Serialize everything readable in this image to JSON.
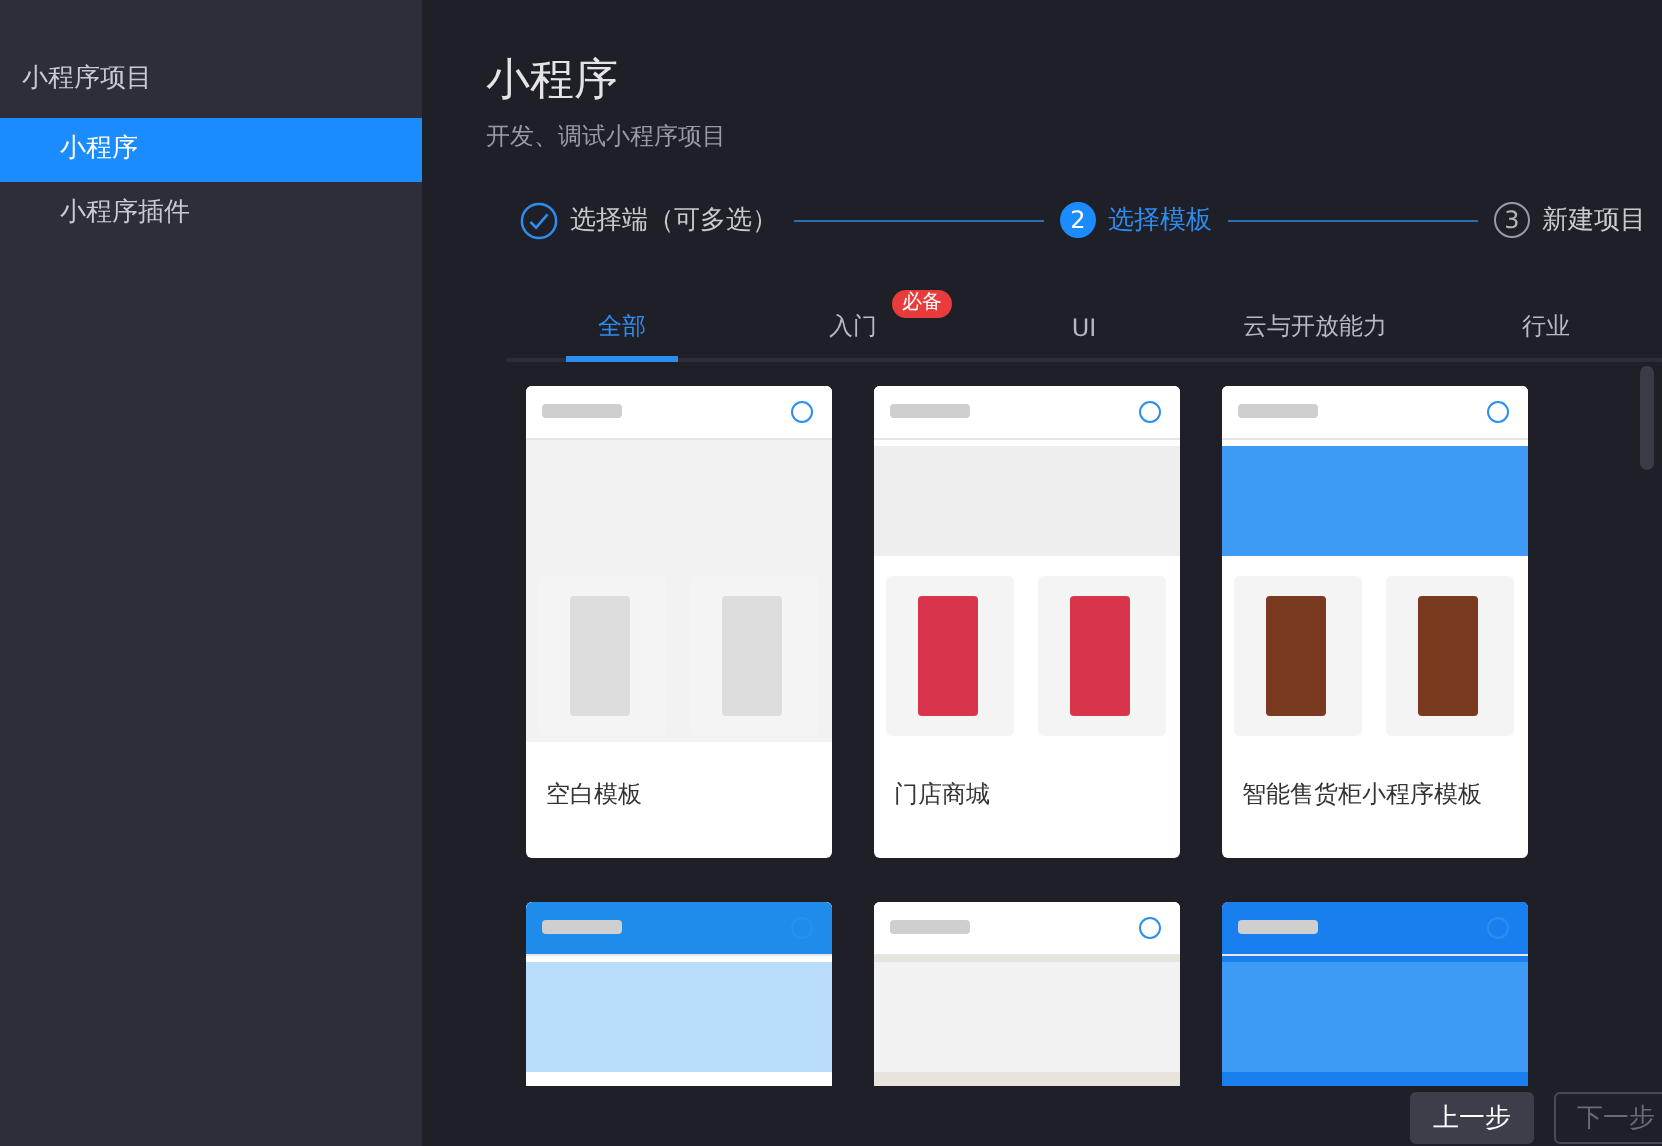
{
  "sidebar": {
    "heading": "小程序项目",
    "items": [
      {
        "label": "小程序",
        "selected": true
      },
      {
        "label": "小程序插件",
        "selected": false
      }
    ]
  },
  "page": {
    "title": "小程序",
    "subtitle": "开发、调试小程序项目"
  },
  "steps": [
    {
      "label": "选择端（可多选）",
      "completed": true,
      "selected": false
    },
    {
      "marker": "2",
      "label": "选择模板",
      "completed": false,
      "selected": true
    },
    {
      "marker": "3",
      "label": "新建项目",
      "completed": false,
      "selected": false
    }
  ],
  "tabs": [
    {
      "label": "全部",
      "selected": true
    },
    {
      "label": "入门",
      "selected": false,
      "badge": "必备"
    },
    {
      "label": "UI",
      "selected": false
    },
    {
      "label": "云与开放能力",
      "selected": false
    },
    {
      "label": "行业",
      "selected": false
    }
  ],
  "templates": [
    {
      "kind": "picture",
      "label": "空白模板"
    },
    {
      "kind": "picture",
      "label": "门店商城"
    },
    {
      "kind": "picture",
      "label": "智能售货柜小程序模板"
    },
    {
      "kind": "picture"
    },
    {
      "kind": "picture"
    },
    {
      "kind": "picture"
    }
  ],
  "buttons": [
    {
      "label": "上一步",
      "disabled": false
    },
    {
      "label": "下一步",
      "disabled": true
    }
  ]
}
